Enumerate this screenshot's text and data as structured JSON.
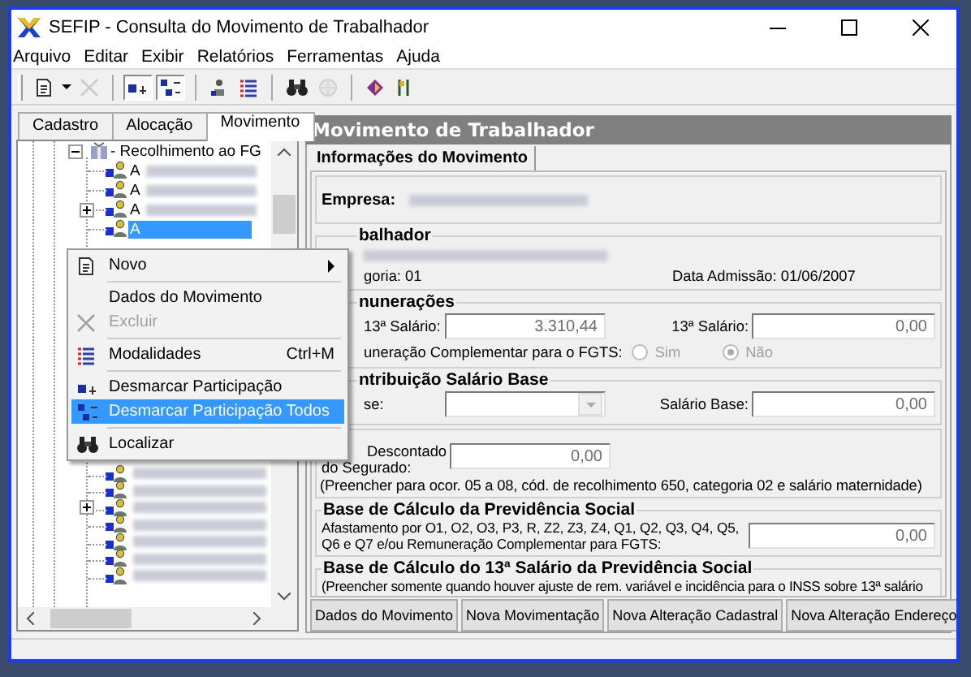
{
  "window": {
    "title": "SEFIP - Consulta do Movimento de Trabalhador"
  },
  "menu": [
    "Arquivo",
    "Editar",
    "Exibir",
    "Relatórios",
    "Ferramentas",
    "Ajuda"
  ],
  "toolbar": [
    {
      "kind": "button",
      "disabled": false,
      "pressed": false
    },
    {
      "kind": "dropdown"
    },
    {
      "kind": "button",
      "disabled": true,
      "pressed": false
    },
    {
      "kind": "separator"
    },
    {
      "kind": "button",
      "disabled": false,
      "pressed": true
    },
    {
      "kind": "button",
      "disabled": false,
      "pressed": true
    },
    {
      "kind": "separator"
    },
    {
      "kind": "button",
      "disabled": false,
      "pressed": false
    },
    {
      "kind": "button",
      "disabled": false,
      "pressed": false
    },
    {
      "kind": "separator"
    },
    {
      "kind": "button",
      "disabled": false,
      "pressed": false
    },
    {
      "kind": "button",
      "disabled": true,
      "pressed": false
    },
    {
      "kind": "separator"
    },
    {
      "kind": "button",
      "disabled": false,
      "pressed": false
    },
    {
      "kind": "button",
      "disabled": false,
      "pressed": false
    }
  ],
  "left_tabs": [
    {
      "label": "Cadastro",
      "selected": false
    },
    {
      "label": "Alocação",
      "selected": false
    },
    {
      "label": "Movimento",
      "selected": true
    }
  ],
  "tree": {
    "label": "- Recolhimento ao FG",
    "expanded": true,
    "children": [
      {
        "label": "A",
        "expandable": false,
        "selected": false
      },
      {
        "label": "A",
        "expandable": false,
        "selected": false
      },
      {
        "label": "A",
        "expandable": true,
        "selected": false
      },
      {
        "label": "A",
        "expandable": false,
        "selected": true
      },
      {
        "expandable": false,
        "selected": false
      },
      {
        "expandable": false,
        "selected": false
      },
      {
        "expandable": true,
        "selected": false
      },
      {
        "expandable": false,
        "selected": false
      },
      {
        "expandable": false,
        "selected": false
      },
      {
        "expandable": false,
        "selected": false
      },
      {
        "expandable": false,
        "selected": false
      }
    ]
  },
  "context_menu": [
    {
      "kind": "item",
      "label": "Novo",
      "submenu": true,
      "disabled": false,
      "selected": false
    },
    {
      "kind": "separator"
    },
    {
      "kind": "item",
      "label": "Dados do Movimento",
      "submenu": false,
      "disabled": false,
      "selected": false
    },
    {
      "kind": "item",
      "label": "Excluir",
      "submenu": false,
      "disabled": true,
      "selected": false
    },
    {
      "kind": "separator"
    },
    {
      "kind": "item",
      "label": "Modalidades",
      "shortcut": "Ctrl+M",
      "submenu": false,
      "disabled": false,
      "selected": false
    },
    {
      "kind": "separator"
    },
    {
      "kind": "item",
      "label": "Desmarcar Participação",
      "submenu": false,
      "disabled": false,
      "selected": false
    },
    {
      "kind": "item",
      "label": "Desmarcar Participação Todos",
      "submenu": false,
      "disabled": false,
      "selected": true
    },
    {
      "kind": "separator"
    },
    {
      "kind": "item",
      "label": "Localizar",
      "submenu": false,
      "disabled": false,
      "selected": false
    }
  ],
  "panel": {
    "title": "Movimento de Trabalhador",
    "tab": "Informações do Movimento",
    "empresa_label": "Empresa:",
    "trabalhador": {
      "title": "balhador",
      "categoria": "goria: 01",
      "admissao": "Data Admissão: 01/06/2007"
    },
    "remuneracoes": {
      "title": "nunerações",
      "label_1": "13ª Salário:",
      "value_1": "3.310,44",
      "label_2": "13ª Salário:",
      "value_2": "0,00",
      "fgts_label": "uneração Complementar para o FGTS:",
      "options": [
        {
          "label": "Sim",
          "selected": false,
          "disabled": true
        },
        {
          "label": "Não",
          "selected": true,
          "disabled": true
        }
      ]
    },
    "contribuicao": {
      "title": "ntribuição Salário Base",
      "label": "se:",
      "label_2": "Salário Base:",
      "value_2": "0,00"
    },
    "descontado": {
      "label_1": "Descontado",
      "label_2": "do Segurado:",
      "value": "0,00",
      "note": "(Preencher para ocor. 05 a 08, cód. de recolhimento 650, categoria 02 e salário maternidade)"
    },
    "base_previdencia": {
      "title": "Base de Cálculo da Previdência Social",
      "text": "Afastamento por O1, O2, O3, P3, R, Z2, Z3, Z4, Q1, Q2, Q3, Q4, Q5, Q6 e Q7  e/ou Remuneração Complementar para FGTS:",
      "value": "0,00"
    },
    "base_13": {
      "title": "Base de Cálculo do 13ª Salário da Previdência Social",
      "text": "(Preencher somente quando houver ajuste de rem. variável e incidência para o INSS sobre 13ª salário"
    },
    "buttons": [
      "Dados do Movimento",
      "Nova Movimentação",
      "Nova Alteração Cadastral",
      "Nova Alteração Endereço"
    ]
  }
}
